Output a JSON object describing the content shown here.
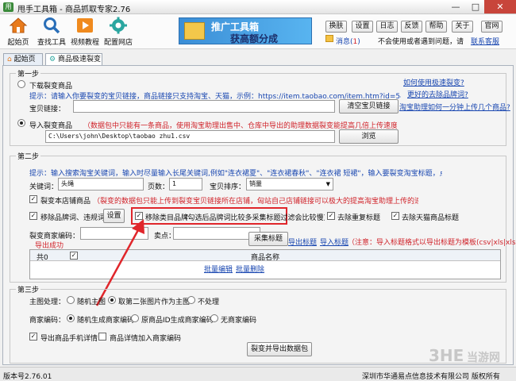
{
  "window": {
    "icon_text": "用",
    "title": "甩手工具箱 - 商品抓取专家2.76"
  },
  "toolbar": {
    "items": [
      {
        "label": "起始页",
        "icon": "home-icon"
      },
      {
        "label": "查找工具",
        "icon": "search-icon"
      },
      {
        "label": "视频教程",
        "icon": "video-icon"
      },
      {
        "label": "配置网店",
        "icon": "store-config-icon"
      }
    ],
    "banner_line1": "推广工具箱",
    "banner_line2": "获高额分成",
    "top_buttons": [
      "换肤",
      "设置",
      "日志",
      "反馈",
      "帮助",
      "关于",
      "官网"
    ],
    "message_label": "消息(",
    "message_count": "1",
    "message_close": ")",
    "no_prompt_text": "不会使用或者遇到问题，请",
    "contact_link": "联系客服"
  },
  "tabs": [
    {
      "label": "起始页",
      "icon": "home-icon"
    },
    {
      "label": "商品极速裂变",
      "icon": "store-config-icon"
    }
  ],
  "step1": {
    "title": "第一步",
    "option_download": "下载裂变商品",
    "hint": "提示：请输入你要裂变的宝贝链接，商品链接只支持淘宝、天猫，示例：https://item.taobao.com/item.htm?id=544925775455",
    "link_label": "宝贝链接：",
    "link_value": "",
    "clear_button": "清空宝贝链接",
    "side_links": [
      "如何使用极速裂变?",
      "更好的去除品牌词?",
      "淘宝助理如何一分钟上传几个商品?"
    ],
    "option_import": "导入裂变商品",
    "import_note": "（数据包中只能有一条商品，使用淘宝助理出售中、仓库中导出的助理数据裂变能提高几倍上传速度）",
    "path_value": "C:\\Users\\john\\Desktop\\taobao zhu1.csv",
    "browse_button": "浏览"
  },
  "step2": {
    "title": "第二步",
    "hint": "提示：输入搜索淘宝关键词，输入时尽量输入长尾关键词,例如\"连衣裙夏\"、\"连衣裙春秋\"、\"连衣裙 短裙\"，输入要裂变淘宝标题，点击采集标题",
    "keyword_label": "关键词：",
    "keyword_value": "头绳",
    "pages_label": "页数：",
    "pages_value": "1",
    "sort_label": "宝贝排序：",
    "sort_value": "销量",
    "fission_shop_label": "裂变本店铺商品",
    "fission_shop_note": "（裂变的数据包只能上传到裂变宝贝链接所在店铺，匈站自己店铺链接可以极大的提高淘宝助理上传的速度）",
    "remove_brand_label": "移除品牌词、违规词",
    "settings_button": "设置",
    "remove_category_label": "移除类目品牌",
    "remove_category_note": "(勾选后品牌词比较多采集标题过滤会比较慢)",
    "remove_dup_label": "去除重复标题",
    "remove_tmall_label": "去除天猫商品标题",
    "merchant_code_label": "裂变商家编码：",
    "merchant_code_value": "",
    "selling_label": "卖点：",
    "selling_value": "",
    "export_status": "导出成功",
    "collect_button": "采集标题",
    "export_title_link": "导出标题",
    "import_title_link": "导入标题",
    "import_note": "（注意：导入标题格式以导出标题为模板(csv|xls|xlsx)）",
    "grid_headers": [
      "共0",
      "✓",
      "商品名称"
    ],
    "grid_rows": [],
    "batch_edit_link": "批量编辑",
    "batch_delete_link": "批量删除"
  },
  "step3": {
    "title": "第三步",
    "main_image_label": "主图处理：",
    "main_image_options": [
      "随机主图",
      "取第二张图片作为主图",
      "不处理"
    ],
    "main_image_selected": 1,
    "merchant_code_label": "商家编码：",
    "merchant_code_options": [
      "随机生成商家编码",
      "原商品ID生成商家编码",
      "无商家编码"
    ],
    "merchant_code_selected": 0,
    "export_mobile_label": "导出商品手机详情",
    "export_mobile_checked": true,
    "detail_code_label": "商品详情加入商家编码",
    "detail_code_checked": false,
    "fission_export_button": "裂变并导出数据包"
  },
  "statusbar": {
    "version": "版本号2.76.01",
    "company": "深圳市华通易点信息技术有限公司 版权所有"
  },
  "watermark": {
    "logo": "3HE",
    "text": "当游网"
  },
  "colors": {
    "accent_red": "#d0232a",
    "link_blue": "#1846b0",
    "panel": "#f4f4f4"
  }
}
